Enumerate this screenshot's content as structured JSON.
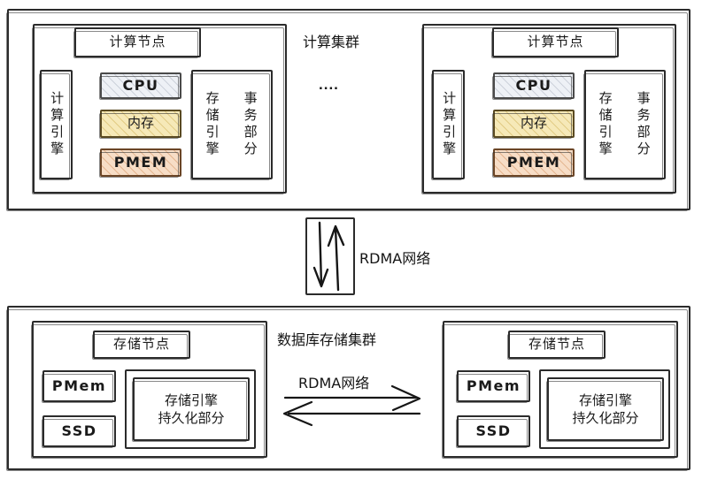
{
  "diagram": {
    "title_compute_cluster": "计算集群",
    "title_storage_cluster": "数据库存储集群",
    "ellipsis": "....",
    "rdma_vertical_label": "RDMA网络",
    "rdma_horizontal_label": "RDMA网络"
  },
  "compute_cluster": {
    "label": "计算集群",
    "ellipsis": "....",
    "nodes": [
      {
        "title": "计算节点",
        "left_column": "计算引擎",
        "blocks": [
          {
            "label": "CPU",
            "fill": "#eef1f6",
            "style": "hatch-blue"
          },
          {
            "label": "内存",
            "fill": "#f6e9b8",
            "style": "hatch-yellow"
          },
          {
            "label": "PMEM",
            "fill": "#f7ddc6",
            "style": "hatch-orange"
          }
        ],
        "right_columns": [
          "存储引擎",
          "事务部分"
        ]
      },
      {
        "title": "计算节点",
        "left_column": "计算引擎",
        "blocks": [
          {
            "label": "CPU",
            "fill": "#eef1f6",
            "style": "hatch-blue"
          },
          {
            "label": "内存",
            "fill": "#f6e9b8",
            "style": "hatch-yellow"
          },
          {
            "label": "PMEM",
            "fill": "#f7ddc6",
            "style": "hatch-orange"
          }
        ],
        "right_columns": [
          "存储引擎",
          "事务部分"
        ]
      }
    ]
  },
  "interconnect": {
    "label": "RDMA网络",
    "direction": "bidirectional-vertical"
  },
  "storage_cluster": {
    "label": "数据库存储集群",
    "inner_link_label": "RDMA网络",
    "nodes": [
      {
        "title": "存储节点",
        "media": [
          "PMem",
          "SSD"
        ],
        "engine_line1": "存储引擎",
        "engine_line2": "持久化部分"
      },
      {
        "title": "存储节点",
        "media": [
          "PMem",
          "SSD"
        ],
        "engine_line1": "存储引擎",
        "engine_line2": "持久化部分"
      }
    ]
  },
  "colors": {
    "stroke": "#2b2b2b",
    "background": "#ffffff",
    "cpu_fill": "#eef1f6",
    "memory_fill": "#f6e9b8",
    "pmem_fill": "#f7ddc6"
  }
}
